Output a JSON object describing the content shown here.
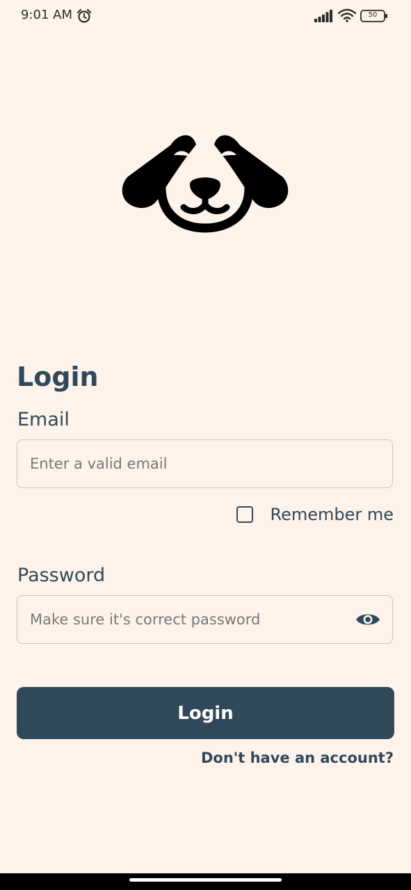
{
  "status_bar": {
    "time": "9:01 AM",
    "battery": "50",
    "icons": [
      "alarm-icon",
      "signal-icon",
      "wifi-icon",
      "battery-icon"
    ]
  },
  "logo": {
    "icon": "dog-face-logo"
  },
  "login": {
    "title": "Login",
    "email_label": "Email",
    "email_placeholder": "Enter a valid email",
    "email_value": "",
    "remember_me_label": "Remember me",
    "remember_me_checked": false,
    "password_label": "Password",
    "password_placeholder": "Make sure it's correct password",
    "password_value": "",
    "password_toggle_icon": "eye-icon",
    "submit_label": "Login",
    "signup_link": "Don't have an account?"
  },
  "colors": {
    "background": "#fdf3ea",
    "primary": "#30495a",
    "button_text": "#ffffff",
    "input_border": "#c9c5c1",
    "placeholder": "#77777b"
  }
}
